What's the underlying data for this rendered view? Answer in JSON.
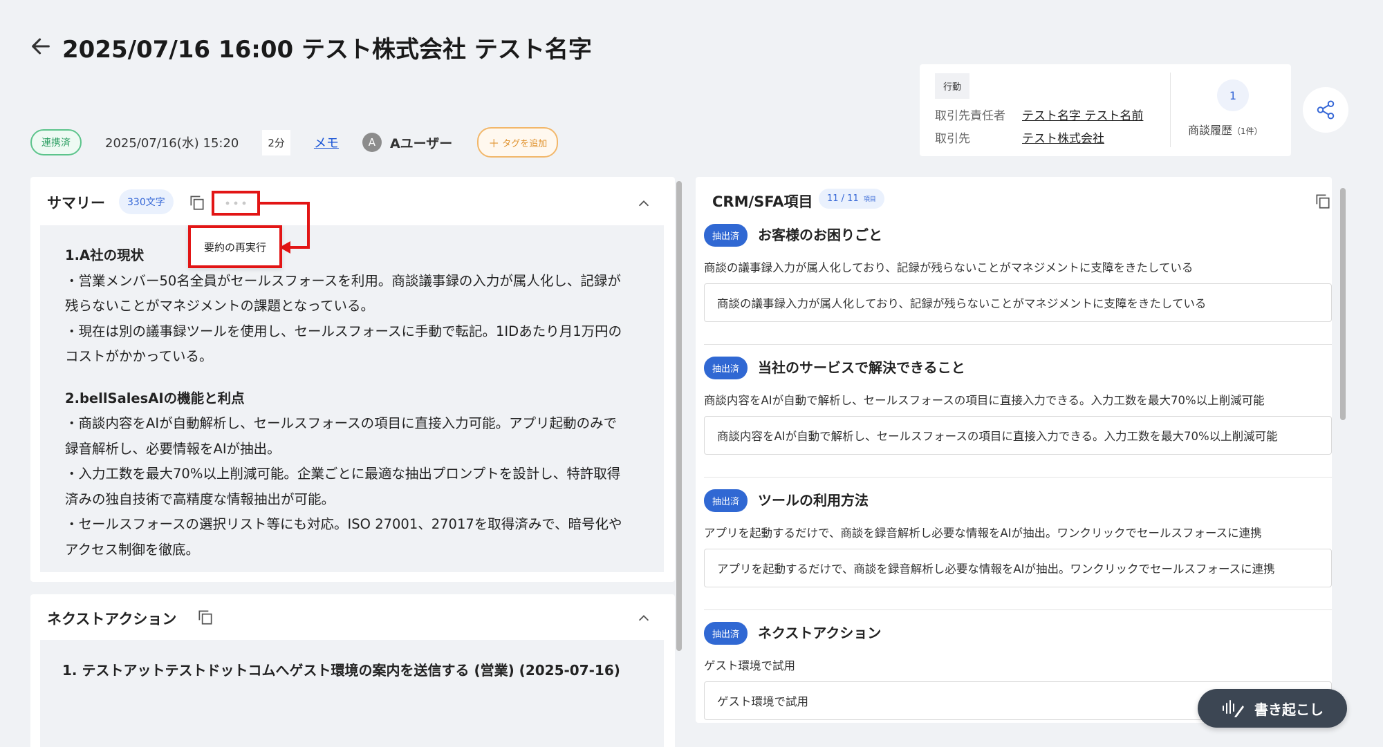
{
  "header": {
    "title": "2025/07/16 16:00 テスト株式会社 テスト名字"
  },
  "meta": {
    "status_badge": "連携済",
    "datetime": "2025/07/16(水) 15:20",
    "duration": "2分",
    "memo_link": "メモ",
    "user_initial": "A",
    "user_name": "Aユーザー",
    "add_tag": "タグを追加"
  },
  "info_card": {
    "action_tag": "行動",
    "contact_label": "取引先責任者",
    "contact_value": "テスト名字 テスト名前",
    "account_label": "取引先",
    "account_value": "テスト株式会社",
    "history_count": "1",
    "history_label": "商談履歴",
    "history_sub": "（1件）"
  },
  "summary": {
    "title": "サマリー",
    "char_count": "330文字",
    "popover_rerun": "要約の再実行",
    "lines": [
      "1.A社の現状",
      "・営業メンバー50名全員がセールスフォースを利用。商談議事録の入力が属人化し、記録が",
      "残らないことがマネジメントの課題となっている。",
      "・現在は別の議事録ツールを使用し、セールスフォースに手動で転記。1IDあたり月1万円の",
      "コストがかかっている。",
      "2.bellSalesAIの機能と利点",
      "・商談内容をAIが自動解析し、セールスフォースの項目に直接入力可能。アプリ起動のみで",
      "録音解析し、必要情報をAIが抽出。",
      "・入力工数を最大70%以上削減可能。企業ごとに最適な抽出プロンプトを設計し、特許取得",
      "済みの独自技術で高精度な情報抽出が可能。",
      "・セールスフォースの選択リスト等にも対応。ISO 27001、27017を取得済みで、暗号化や",
      "アクセス制御を徹底。"
    ]
  },
  "next_action": {
    "title": "ネクストアクション",
    "items": [
      "1. テストアットテストドットコムへゲスト環境の案内を送信する (営業) (2025-07-16)"
    ]
  },
  "crm": {
    "title": "CRM/SFA項目",
    "count": "11 / 11",
    "count_unit": "項目",
    "sections": [
      {
        "badge": "抽出済",
        "heading": "お客様のお困りごと",
        "desc": "商談の議事録入力が属人化しており、記録が残らないことがマネジメントに支障をきたしている",
        "value": "商談の議事録入力が属人化しており、記録が残らないことがマネジメントに支障をきたしている"
      },
      {
        "badge": "抽出済",
        "heading": "当社のサービスで解決できること",
        "desc": "商談内容をAIが自動で解析し、セールスフォースの項目に直接入力できる。入力工数を最大70%以上削減可能",
        "value": "商談内容をAIが自動で解析し、セールスフォースの項目に直接入力できる。入力工数を最大70%以上削減可能"
      },
      {
        "badge": "抽出済",
        "heading": "ツールの利用方法",
        "desc": "アプリを起動するだけで、商談を録音解析し必要な情報をAIが抽出。ワンクリックでセールスフォースに連携",
        "value": "アプリを起動するだけで、商談を録音解析し必要な情報をAIが抽出。ワンクリックでセールスフォースに連携"
      },
      {
        "badge": "抽出済",
        "heading": "ネクストアクション",
        "desc": "ゲスト環境で試用",
        "value": "ゲスト環境で試用"
      }
    ]
  },
  "transcribe_button": "書き起こし",
  "colors": {
    "accent_blue": "#3068d3",
    "annotation_red": "#e21515",
    "linked_green": "#2e9f63",
    "tag_orange": "#e0922e"
  }
}
